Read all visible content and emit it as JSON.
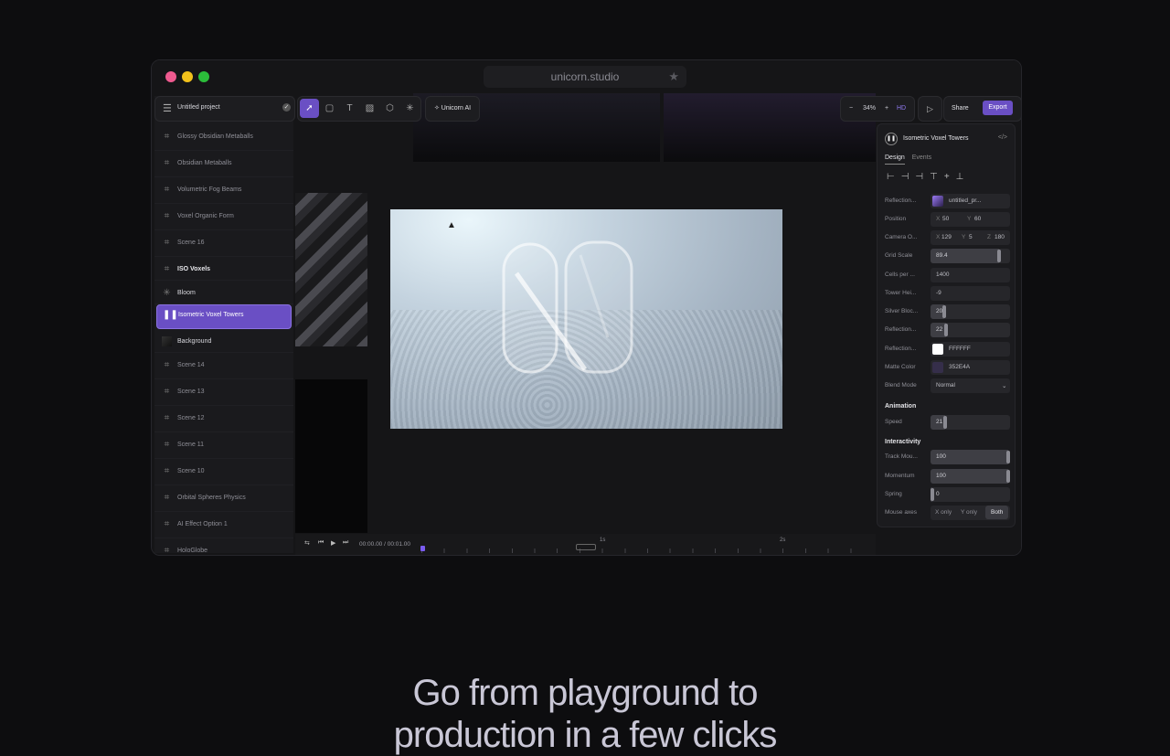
{
  "browser": {
    "url": "unicorn.studio"
  },
  "project": {
    "name": "Untitled project"
  },
  "layers": [
    {
      "label": "Glossy Obsidian Metaballs",
      "style": "normal",
      "icon": "frame-icon"
    },
    {
      "label": "Obsidian Metaballs",
      "style": "normal",
      "icon": "frame-icon"
    },
    {
      "label": "Volumetric Fog Beams",
      "style": "normal",
      "icon": "frame-icon"
    },
    {
      "label": "Voxel Organic Form",
      "style": "normal",
      "icon": "frame-icon"
    },
    {
      "label": "Scene 16",
      "style": "normal",
      "icon": "frame-icon"
    },
    {
      "label": "ISO Voxels",
      "style": "bold",
      "icon": "frame-icon"
    },
    {
      "label": "Bloom",
      "style": "white",
      "icon": "asterisk-icon"
    },
    {
      "label": "Isometric Voxel Towers",
      "style": "active",
      "icon": "pause-icon"
    },
    {
      "label": "Background",
      "style": "white",
      "icon": "image-thumb-icon"
    },
    {
      "label": "Scene 14",
      "style": "normal",
      "icon": "frame-icon"
    },
    {
      "label": "Scene 13",
      "style": "normal",
      "icon": "frame-icon"
    },
    {
      "label": "Scene 12",
      "style": "normal",
      "icon": "frame-icon"
    },
    {
      "label": "Scene 11",
      "style": "normal",
      "icon": "frame-icon"
    },
    {
      "label": "Scene 10",
      "style": "normal",
      "icon": "frame-icon"
    },
    {
      "label": "Orbital Spheres Physics",
      "style": "normal",
      "icon": "frame-icon"
    },
    {
      "label": "AI Effect Option 1",
      "style": "normal",
      "icon": "frame-icon"
    },
    {
      "label": "HoloGlobe",
      "style": "normal",
      "icon": "frame-icon"
    }
  ],
  "toolbar": {
    "ai_label": "Unicorn AI",
    "zoom": "34%",
    "quality": "HD",
    "share": "Share",
    "export": "Export"
  },
  "panel": {
    "title": "Isometric Voxel Towers",
    "tabs": [
      "Design",
      "Events"
    ],
    "reflection_map": {
      "label": "Reflection...",
      "value": "untitled_pr..."
    },
    "position": {
      "label": "Position",
      "x_label": "X",
      "x": "50",
      "y_label": "Y",
      "y": "60"
    },
    "camera": {
      "label": "Camera O...",
      "x_label": "X",
      "x": "129",
      "y_label": "Y",
      "y": "5",
      "z_label": "Z",
      "z": "180"
    },
    "grid_scale": {
      "label": "Grid Scale",
      "value": "89.4",
      "level": 0.88
    },
    "cells_per": {
      "label": "Cells per ...",
      "value": "1400"
    },
    "tower_height": {
      "label": "Tower Hei...",
      "value": "-9"
    },
    "silver_blocks": {
      "label": "Silver Bloc...",
      "value": "20",
      "level": 0.2
    },
    "reflection": {
      "label": "Reflection...",
      "value": "22",
      "level": 0.22
    },
    "reflection_color": {
      "label": "Reflection...",
      "value": "FFFFFF",
      "color": "#FFFFFF"
    },
    "matte_color": {
      "label": "Matte Color",
      "value": "352E4A",
      "color": "#352E4A"
    },
    "blend_mode": {
      "label": "Blend Mode",
      "value": "Normal"
    },
    "animation_title": "Animation",
    "speed": {
      "label": "Speed",
      "value": "21",
      "level": 0.21
    },
    "interactivity_title": "Interactivity",
    "track_mouse": {
      "label": "Track Mou...",
      "value": "100",
      "level": 1.0
    },
    "momentum": {
      "label": "Momentum",
      "value": "100",
      "level": 1.0
    },
    "spring": {
      "label": "Spring",
      "value": "0",
      "level": 0.0
    },
    "mouse_axes": {
      "label": "Mouse axes",
      "options": [
        "X only",
        "Y only",
        "Both"
      ],
      "selected": "Both"
    }
  },
  "timeline": {
    "time": "00:00.00 / 00:01.00",
    "marks": [
      "1s",
      "2s"
    ]
  },
  "headline": {
    "line1": "Go from playground to",
    "line2": "production in a few clicks"
  },
  "colors": {
    "accent": "#6A4FC4",
    "background": "#0D0D0F"
  }
}
